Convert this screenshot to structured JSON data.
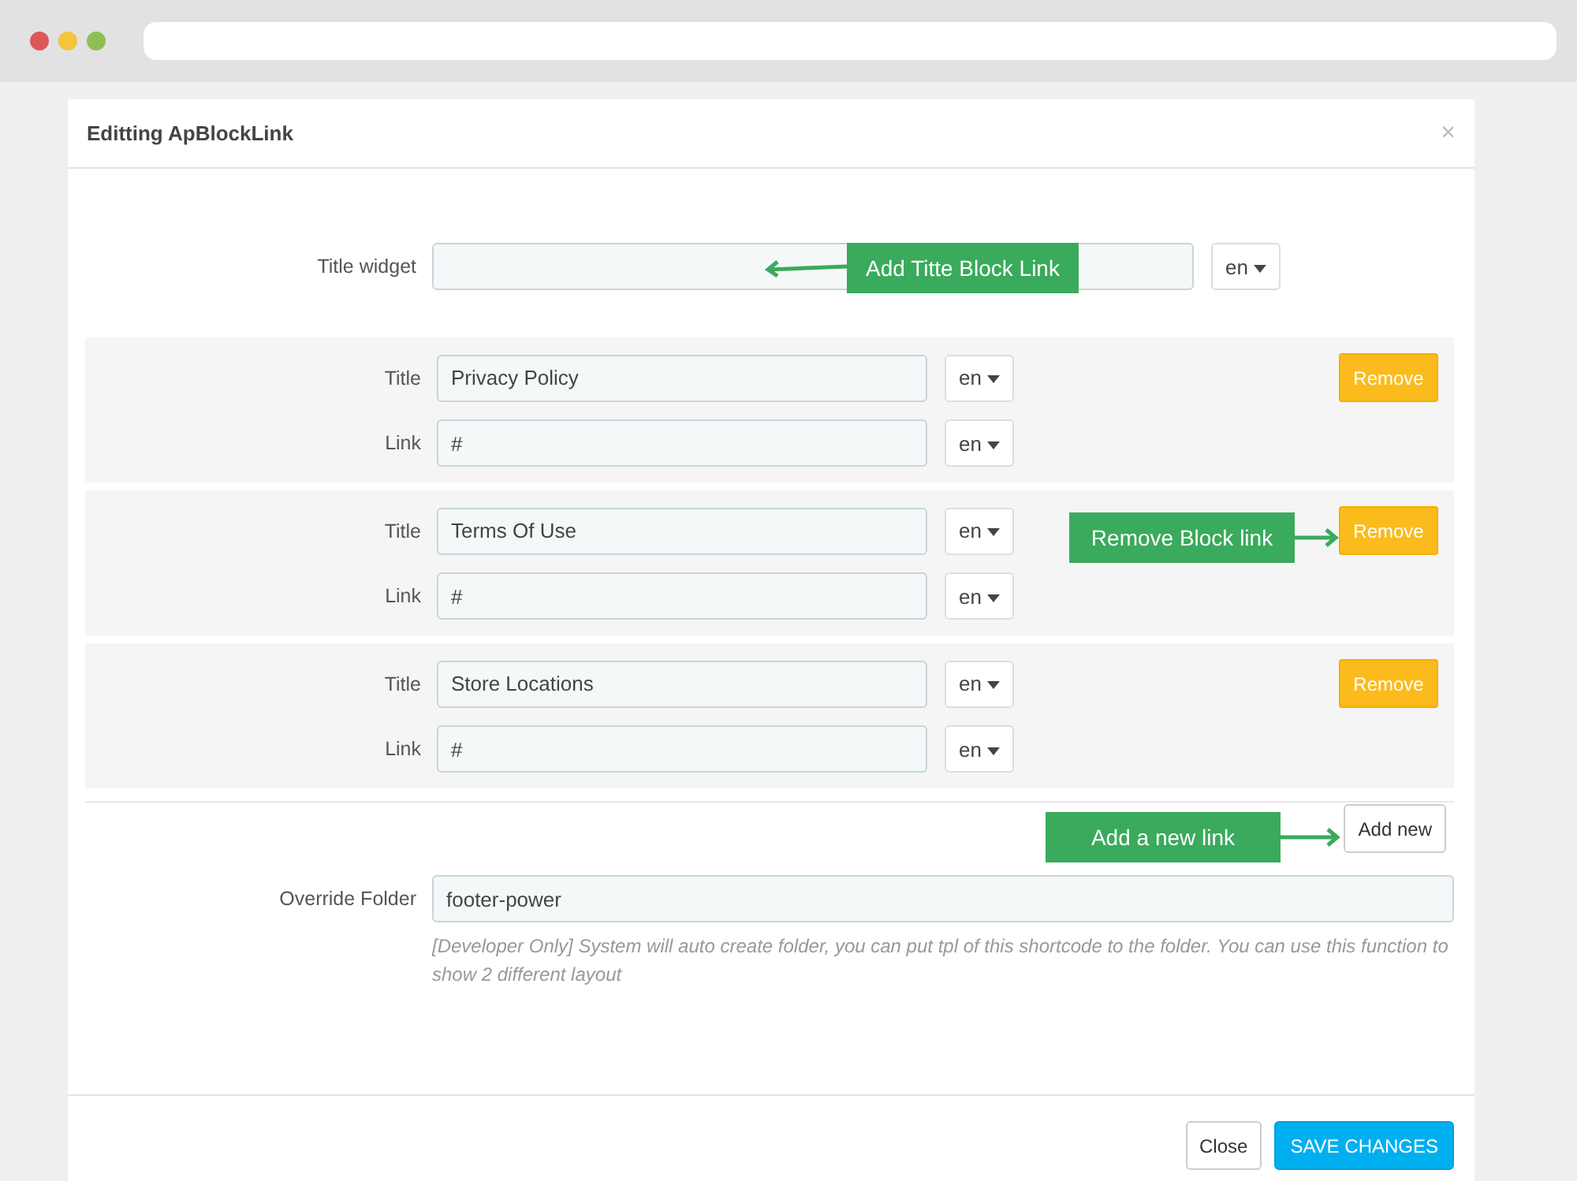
{
  "modal": {
    "title": "Editting ApBlockLink",
    "close_glyph": "×"
  },
  "title_widget": {
    "label": "Title widget",
    "lang": "en"
  },
  "links": [
    {
      "title_label": "Title",
      "title": "Privacy Policy",
      "title_lang": "en",
      "link_label": "Link",
      "link": "#",
      "link_lang": "en",
      "remove": "Remove"
    },
    {
      "title_label": "Title",
      "title": "Terms Of Use",
      "title_lang": "en",
      "link_label": "Link",
      "link": "#",
      "link_lang": "en",
      "remove": "Remove"
    },
    {
      "title_label": "Title",
      "title": "Store Locations",
      "title_lang": "en",
      "link_label": "Link",
      "link": "#",
      "link_lang": "en",
      "remove": "Remove"
    }
  ],
  "add_new": "Add new",
  "override_folder": {
    "label": "Override Folder",
    "value": "footer-power",
    "help": "[Developer Only] System will auto create folder, you can put tpl of this shortcode to the folder. You can use this function to show 2 different layout"
  },
  "footer": {
    "close": "Close",
    "save": "SAVE CHANGES"
  },
  "annotations": [
    {
      "text": "Add Titte Block Link"
    },
    {
      "text": "Remove Block link"
    },
    {
      "text": "Add a new link"
    }
  ]
}
